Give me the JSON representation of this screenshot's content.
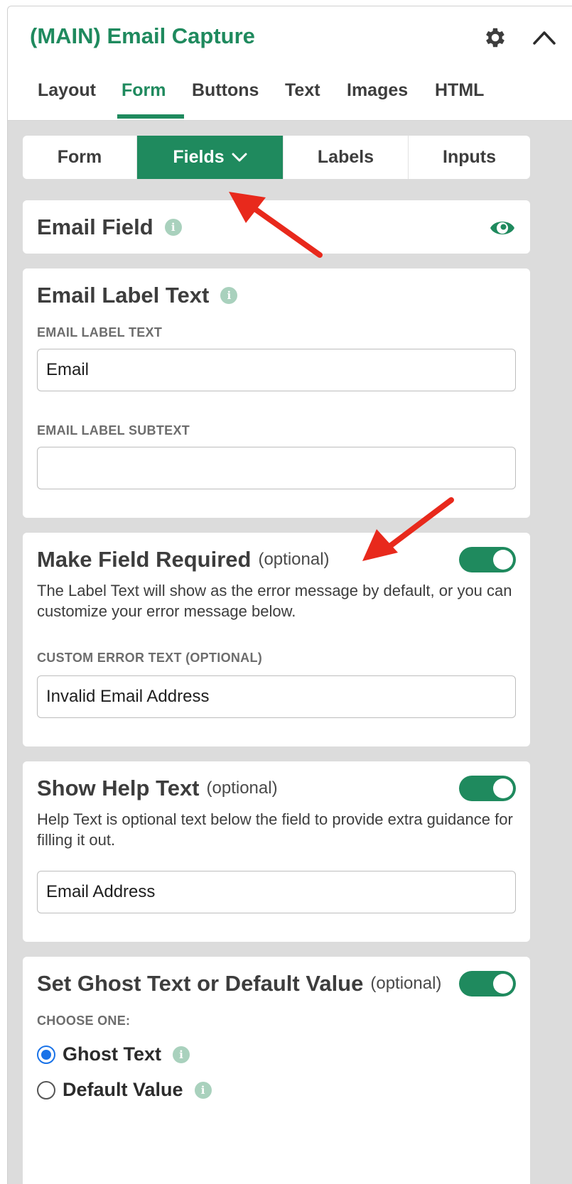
{
  "header": {
    "title": "(MAIN) Email Capture"
  },
  "main_tabs": [
    {
      "label": "Layout"
    },
    {
      "label": "Form"
    },
    {
      "label": "Buttons"
    },
    {
      "label": "Text"
    },
    {
      "label": "Images"
    },
    {
      "label": "HTML"
    }
  ],
  "active_main_tab": "Form",
  "sub_tabs": [
    {
      "label": "Form"
    },
    {
      "label": "Fields"
    },
    {
      "label": "Labels"
    },
    {
      "label": "Inputs"
    }
  ],
  "active_sub_tab": "Fields",
  "email_field": {
    "title": "Email Field"
  },
  "email_label": {
    "title": "Email Label Text",
    "label_text_label": "EMAIL LABEL TEXT",
    "label_text_value": "Email",
    "subtext_label": "EMAIL LABEL SUBTEXT",
    "subtext_value": ""
  },
  "required": {
    "title": "Make Field Required",
    "optional": "(optional)",
    "description": "The Label Text will show as the error message by default, or you can customize your error message below.",
    "error_label": "CUSTOM ERROR TEXT (OPTIONAL)",
    "error_value": "Invalid Email Address",
    "enabled": true
  },
  "help_text": {
    "title": "Show Help Text",
    "optional": "(optional)",
    "description": "Help Text is optional text below the field to provide extra guidance for filling it out.",
    "value": "Email Address",
    "enabled": true
  },
  "ghost": {
    "title": "Set Ghost Text or Default Value",
    "optional": "(optional)",
    "choose_label": "CHOOSE ONE:",
    "options": [
      {
        "label": "Ghost Text",
        "checked": true
      },
      {
        "label": "Default Value",
        "checked": false
      }
    ],
    "enabled": true
  },
  "colors": {
    "brand_green": "#1f8a5e",
    "panel_bg": "#dcdcdc",
    "annotation_arrow": "#e8291c",
    "radio_blue": "#1a73e8"
  }
}
